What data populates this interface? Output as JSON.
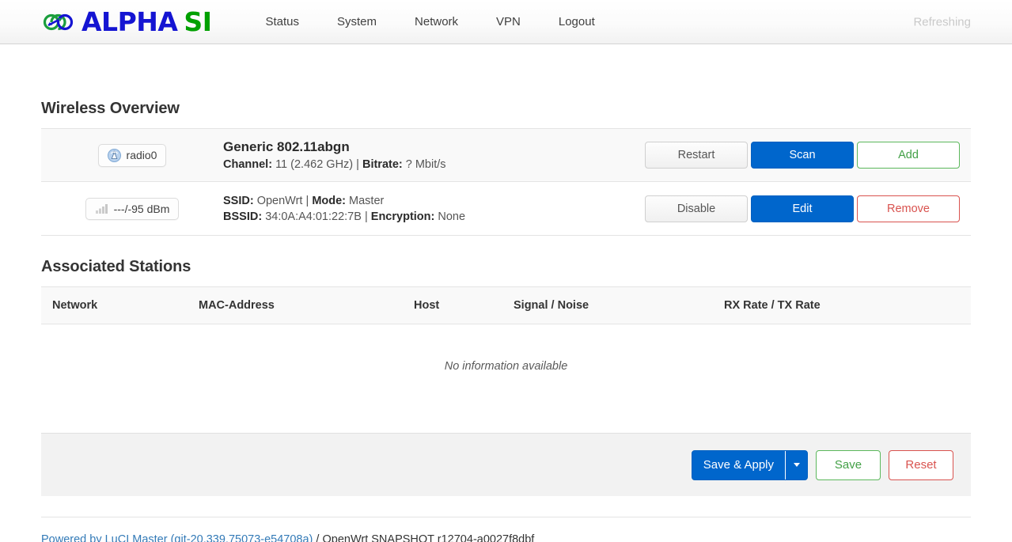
{
  "header": {
    "brand": {
      "icon": "infinity-loop-icon",
      "alpha": "ALPHA",
      "si": "SI"
    },
    "nav": [
      {
        "label": "Status"
      },
      {
        "label": "System"
      },
      {
        "label": "Network"
      },
      {
        "label": "VPN"
      },
      {
        "label": "Logout"
      }
    ],
    "status_text": "Refreshing"
  },
  "wireless": {
    "title": "Wireless Overview",
    "radio": {
      "badge_icon": "antenna-broadcast-icon",
      "badge_label": "radio0",
      "device": "Generic 802.11abgn",
      "detail_channel_label": "Channel:",
      "detail_channel_value": "11 (2.462 GHz)",
      "detail_separator": "|",
      "detail_bitrate_label": "Bitrate:",
      "detail_bitrate_value": "? Mbit/s",
      "buttons": {
        "restart": "Restart",
        "scan": "Scan",
        "add": "Add"
      }
    },
    "iface": {
      "badge_icon": "signal-bars-icon",
      "badge_label": "---/-95 dBm",
      "ssid_label": "SSID:",
      "ssid_value": "OpenWrt",
      "mode_label": "Mode:",
      "mode_value": "Master",
      "bssid_label": "BSSID:",
      "bssid_value": "34:0A:A4:01:22:7B",
      "encryption_label": "Encryption:",
      "encryption_value": "None",
      "separator": "|",
      "buttons": {
        "disable": "Disable",
        "edit": "Edit",
        "remove": "Remove"
      }
    }
  },
  "stations": {
    "title": "Associated Stations",
    "columns": [
      "Network",
      "MAC-Address",
      "Host",
      "Signal / Noise",
      "RX Rate / TX Rate"
    ],
    "empty_text": "No information available"
  },
  "actions": {
    "save_apply": "Save & Apply",
    "save": "Save",
    "reset": "Reset"
  },
  "footer": {
    "link_text": "Powered by LuCI Master (git-20.339.75073-e54708a)",
    "suffix_text": " / OpenWrt SNAPSHOT r12704-a0027f8dbf"
  },
  "colors": {
    "primary": "#0066cc",
    "success": "#43a047",
    "danger": "#d9534f",
    "brand_blue": "#1414d2",
    "brand_green": "#00a000",
    "link": "#337ab7"
  }
}
